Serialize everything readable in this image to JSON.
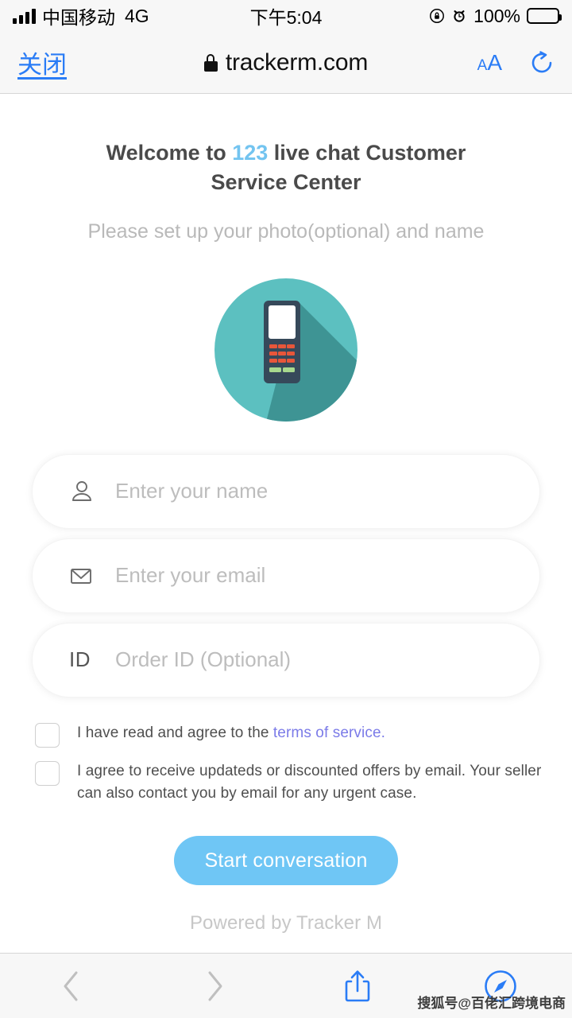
{
  "status_bar": {
    "carrier": "中国移动",
    "network": "4G",
    "time": "下午5:04",
    "battery_percent": "100%",
    "signal_icon": "signal-bars-icon",
    "rotation_lock_icon": "rotation-lock-icon",
    "alarm_icon": "alarm-clock-icon",
    "battery_icon": "battery-full-icon"
  },
  "browser_bar": {
    "close_label": "关闭",
    "url": "trackerm.com",
    "lock_icon": "lock-icon",
    "text_size_small": "A",
    "text_size_large": "A",
    "reload_icon": "reload-icon"
  },
  "page": {
    "title_prefix": "Welcome to ",
    "title_highlight": "123",
    "title_suffix": " live chat Customer Service Center",
    "subtitle": "Please set up your photo(optional) and name",
    "avatar_icon": "mobile-phone-illustration",
    "fields": [
      {
        "name": "name-field",
        "icon": "person-icon",
        "placeholder": "Enter your name",
        "value": ""
      },
      {
        "name": "email-field",
        "icon": "envelope-icon",
        "placeholder": "Enter your email",
        "value": ""
      },
      {
        "name": "order-id-field",
        "icon": "id-icon",
        "icon_text": "ID",
        "placeholder": "Order ID (Optional)",
        "value": ""
      }
    ],
    "checkboxes": [
      {
        "name": "terms-checkbox",
        "checked": false,
        "text_before": "I have read and agree to the ",
        "link_text": "terms of service.",
        "text_after": ""
      },
      {
        "name": "marketing-checkbox",
        "checked": false,
        "text_before": "I agree to receive updateds or discounted offers by email. Your seller can also contact you by email for any urgent case.",
        "link_text": "",
        "text_after": ""
      }
    ],
    "start_button": "Start conversation",
    "powered_by": "Powered by Tracker M"
  },
  "toolbar": {
    "back_icon": "chevron-left-icon",
    "forward_icon": "chevron-right-icon",
    "share_icon": "share-icon",
    "safari_icon": "safari-compass-icon"
  },
  "watermark": "搜狐号@百佬汇跨境电商",
  "colors": {
    "ios_blue": "#2a7cf6",
    "accent_blue": "#73c4f0",
    "button_blue": "#6fc6f5",
    "link_purple": "#7b7be8",
    "avatar_teal": "#5cc0c0",
    "avatar_teal_shadow": "#3e9494",
    "phone_body": "#36495a",
    "key_orange": "#e8563a",
    "key_green": "#a8d98e"
  }
}
